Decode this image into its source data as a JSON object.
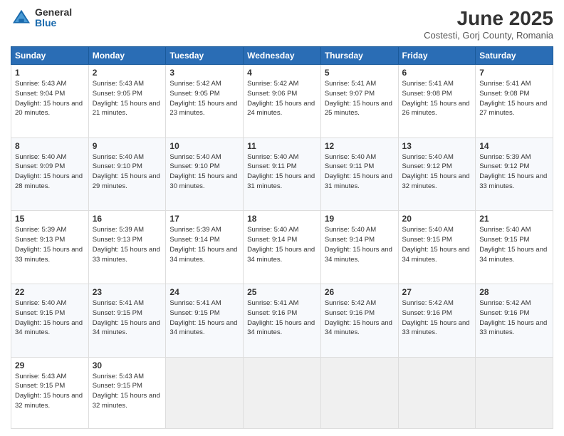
{
  "logo": {
    "general": "General",
    "blue": "Blue"
  },
  "title": "June 2025",
  "location": "Costesti, Gorj County, Romania",
  "headers": [
    "Sunday",
    "Monday",
    "Tuesday",
    "Wednesday",
    "Thursday",
    "Friday",
    "Saturday"
  ],
  "weeks": [
    [
      {
        "day": "1",
        "sunrise": "5:43 AM",
        "sunset": "9:04 PM",
        "daylight": "15 hours and 20 minutes."
      },
      {
        "day": "2",
        "sunrise": "5:43 AM",
        "sunset": "9:05 PM",
        "daylight": "15 hours and 21 minutes."
      },
      {
        "day": "3",
        "sunrise": "5:42 AM",
        "sunset": "9:05 PM",
        "daylight": "15 hours and 23 minutes."
      },
      {
        "day": "4",
        "sunrise": "5:42 AM",
        "sunset": "9:06 PM",
        "daylight": "15 hours and 24 minutes."
      },
      {
        "day": "5",
        "sunrise": "5:41 AM",
        "sunset": "9:07 PM",
        "daylight": "15 hours and 25 minutes."
      },
      {
        "day": "6",
        "sunrise": "5:41 AM",
        "sunset": "9:08 PM",
        "daylight": "15 hours and 26 minutes."
      },
      {
        "day": "7",
        "sunrise": "5:41 AM",
        "sunset": "9:08 PM",
        "daylight": "15 hours and 27 minutes."
      }
    ],
    [
      {
        "day": "8",
        "sunrise": "5:40 AM",
        "sunset": "9:09 PM",
        "daylight": "15 hours and 28 minutes."
      },
      {
        "day": "9",
        "sunrise": "5:40 AM",
        "sunset": "9:10 PM",
        "daylight": "15 hours and 29 minutes."
      },
      {
        "day": "10",
        "sunrise": "5:40 AM",
        "sunset": "9:10 PM",
        "daylight": "15 hours and 30 minutes."
      },
      {
        "day": "11",
        "sunrise": "5:40 AM",
        "sunset": "9:11 PM",
        "daylight": "15 hours and 31 minutes."
      },
      {
        "day": "12",
        "sunrise": "5:40 AM",
        "sunset": "9:11 PM",
        "daylight": "15 hours and 31 minutes."
      },
      {
        "day": "13",
        "sunrise": "5:40 AM",
        "sunset": "9:12 PM",
        "daylight": "15 hours and 32 minutes."
      },
      {
        "day": "14",
        "sunrise": "5:39 AM",
        "sunset": "9:12 PM",
        "daylight": "15 hours and 33 minutes."
      }
    ],
    [
      {
        "day": "15",
        "sunrise": "5:39 AM",
        "sunset": "9:13 PM",
        "daylight": "15 hours and 33 minutes."
      },
      {
        "day": "16",
        "sunrise": "5:39 AM",
        "sunset": "9:13 PM",
        "daylight": "15 hours and 33 minutes."
      },
      {
        "day": "17",
        "sunrise": "5:39 AM",
        "sunset": "9:14 PM",
        "daylight": "15 hours and 34 minutes."
      },
      {
        "day": "18",
        "sunrise": "5:40 AM",
        "sunset": "9:14 PM",
        "daylight": "15 hours and 34 minutes."
      },
      {
        "day": "19",
        "sunrise": "5:40 AM",
        "sunset": "9:14 PM",
        "daylight": "15 hours and 34 minutes."
      },
      {
        "day": "20",
        "sunrise": "5:40 AM",
        "sunset": "9:15 PM",
        "daylight": "15 hours and 34 minutes."
      },
      {
        "day": "21",
        "sunrise": "5:40 AM",
        "sunset": "9:15 PM",
        "daylight": "15 hours and 34 minutes."
      }
    ],
    [
      {
        "day": "22",
        "sunrise": "5:40 AM",
        "sunset": "9:15 PM",
        "daylight": "15 hours and 34 minutes."
      },
      {
        "day": "23",
        "sunrise": "5:41 AM",
        "sunset": "9:15 PM",
        "daylight": "15 hours and 34 minutes."
      },
      {
        "day": "24",
        "sunrise": "5:41 AM",
        "sunset": "9:15 PM",
        "daylight": "15 hours and 34 minutes."
      },
      {
        "day": "25",
        "sunrise": "5:41 AM",
        "sunset": "9:16 PM",
        "daylight": "15 hours and 34 minutes."
      },
      {
        "day": "26",
        "sunrise": "5:42 AM",
        "sunset": "9:16 PM",
        "daylight": "15 hours and 34 minutes."
      },
      {
        "day": "27",
        "sunrise": "5:42 AM",
        "sunset": "9:16 PM",
        "daylight": "15 hours and 33 minutes."
      },
      {
        "day": "28",
        "sunrise": "5:42 AM",
        "sunset": "9:16 PM",
        "daylight": "15 hours and 33 minutes."
      }
    ],
    [
      {
        "day": "29",
        "sunrise": "5:43 AM",
        "sunset": "9:15 PM",
        "daylight": "15 hours and 32 minutes."
      },
      {
        "day": "30",
        "sunrise": "5:43 AM",
        "sunset": "9:15 PM",
        "daylight": "15 hours and 32 minutes."
      },
      null,
      null,
      null,
      null,
      null
    ]
  ]
}
